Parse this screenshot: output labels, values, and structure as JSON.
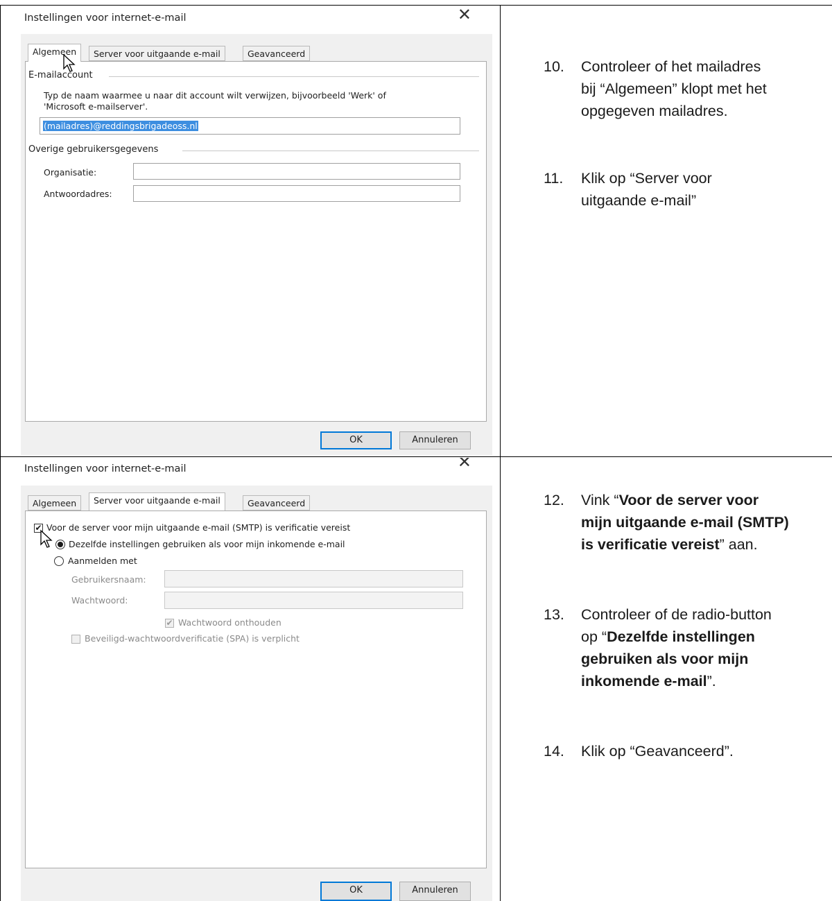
{
  "dialog_title": "Instellingen voor internet-e-mail",
  "close_icon": "close-icon",
  "tabs": [
    "Algemeen",
    "Server voor uitgaande e-mail",
    "Geavanceerd"
  ],
  "dialog1": {
    "group_email": "E-mailaccount",
    "description_line1": "Typ de naam waarmee u naar dit account wilt verwijzen, bijvoorbeeld 'Werk' of",
    "description_line2": "'Microsoft e-mailserver'.",
    "account_name_value": "(mailadres)@reddingsbrigadeoss.nl",
    "group_other": "Overige gebruikersgegevens",
    "organization_label": "Organisatie:",
    "organization_value": "",
    "reply_label": "Antwoordadres:",
    "reply_value": ""
  },
  "dialog2": {
    "smtp_auth_label": "Voor de server voor mijn uitgaande e-mail (SMTP) is verificatie vereist",
    "smtp_auth_checked": true,
    "same_settings_label": "Dezelfde instellingen gebruiken als voor mijn inkomende e-mail",
    "same_settings_selected": true,
    "login_with_label": "Aanmelden met",
    "username_label": "Gebruikersnaam:",
    "password_label": "Wachtwoord:",
    "remember_password_label": "Wachtwoord onthouden",
    "remember_password_checked": true,
    "spa_label": "Beveiligd-wachtwoordverificatie (SPA) is verplicht",
    "spa_checked": false
  },
  "buttons": {
    "ok": "OK",
    "cancel": "Annuleren"
  },
  "steps": {
    "s10_num": "10.",
    "s10_l1": "Controleer of het mailadres",
    "s10_l2": "bij “Algemeen” klopt met het",
    "s10_l3": "opgegeven mailadres.",
    "s11_num": "11.",
    "s11_l1": "Klik op “Server voor",
    "s11_l2": "uitgaande e-mail”",
    "s12_num": "12.",
    "s12_l1_pre": "Vink “",
    "s12_l1_bold": "Voor de server voor",
    "s12_l2_bold": "mijn uitgaande e-mail (SMTP)",
    "s12_l3_bold": "is verificatie vereist",
    "s12_l3_post": "” aan.",
    "s13_num": "13.",
    "s13_l1": "Controleer of de radio-button",
    "s13_l2_pre": "op “",
    "s13_l2_bold": "Dezelfde instellingen",
    "s13_l3_bold": "gebruiken als voor mijn",
    "s13_l4_bold": "inkomende e-mail",
    "s13_l4_post": "”.",
    "s14_num": "14.",
    "s14_l1": "Klik op “Geavanceerd”."
  }
}
